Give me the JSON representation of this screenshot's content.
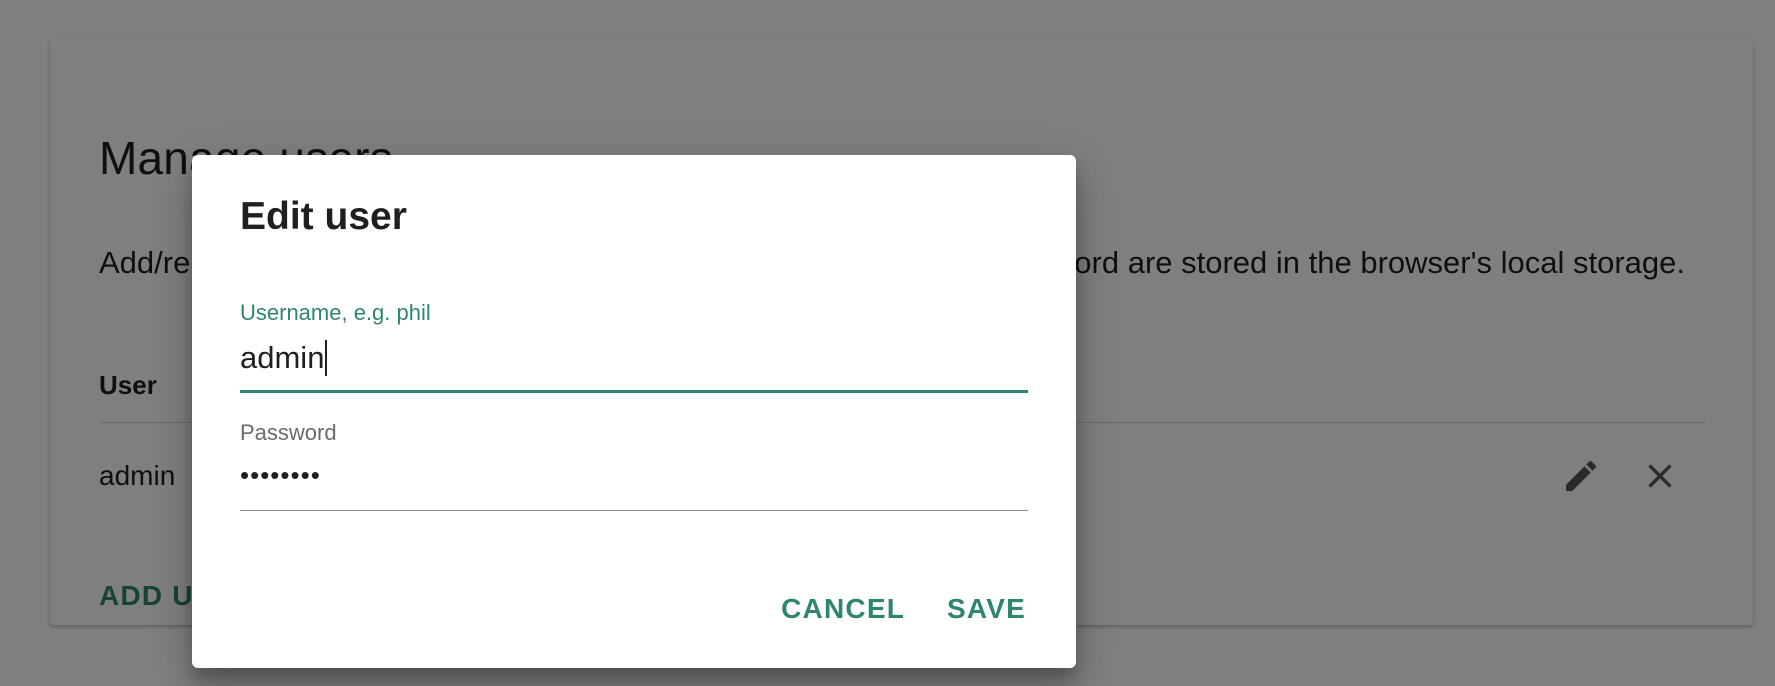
{
  "page": {
    "title": "Manage users",
    "description": "Add/remove users for this instance. Note that the username and password are stored in the browser's local storage.",
    "table": {
      "header": "User",
      "rows": [
        {
          "username": "admin"
        }
      ]
    },
    "add_user_label": "ADD USER",
    "icons": {
      "edit": "pencil-icon",
      "delete": "close-icon"
    }
  },
  "dialog": {
    "title": "Edit user",
    "username": {
      "label": "Username, e.g. phil",
      "value": "admin"
    },
    "password": {
      "label": "Password",
      "value": "••••••••"
    },
    "cancel_label": "CANCEL",
    "save_label": "SAVE"
  },
  "colors": {
    "accent": "#2f8670",
    "scrim": "rgba(0,0,0,0.5)"
  }
}
